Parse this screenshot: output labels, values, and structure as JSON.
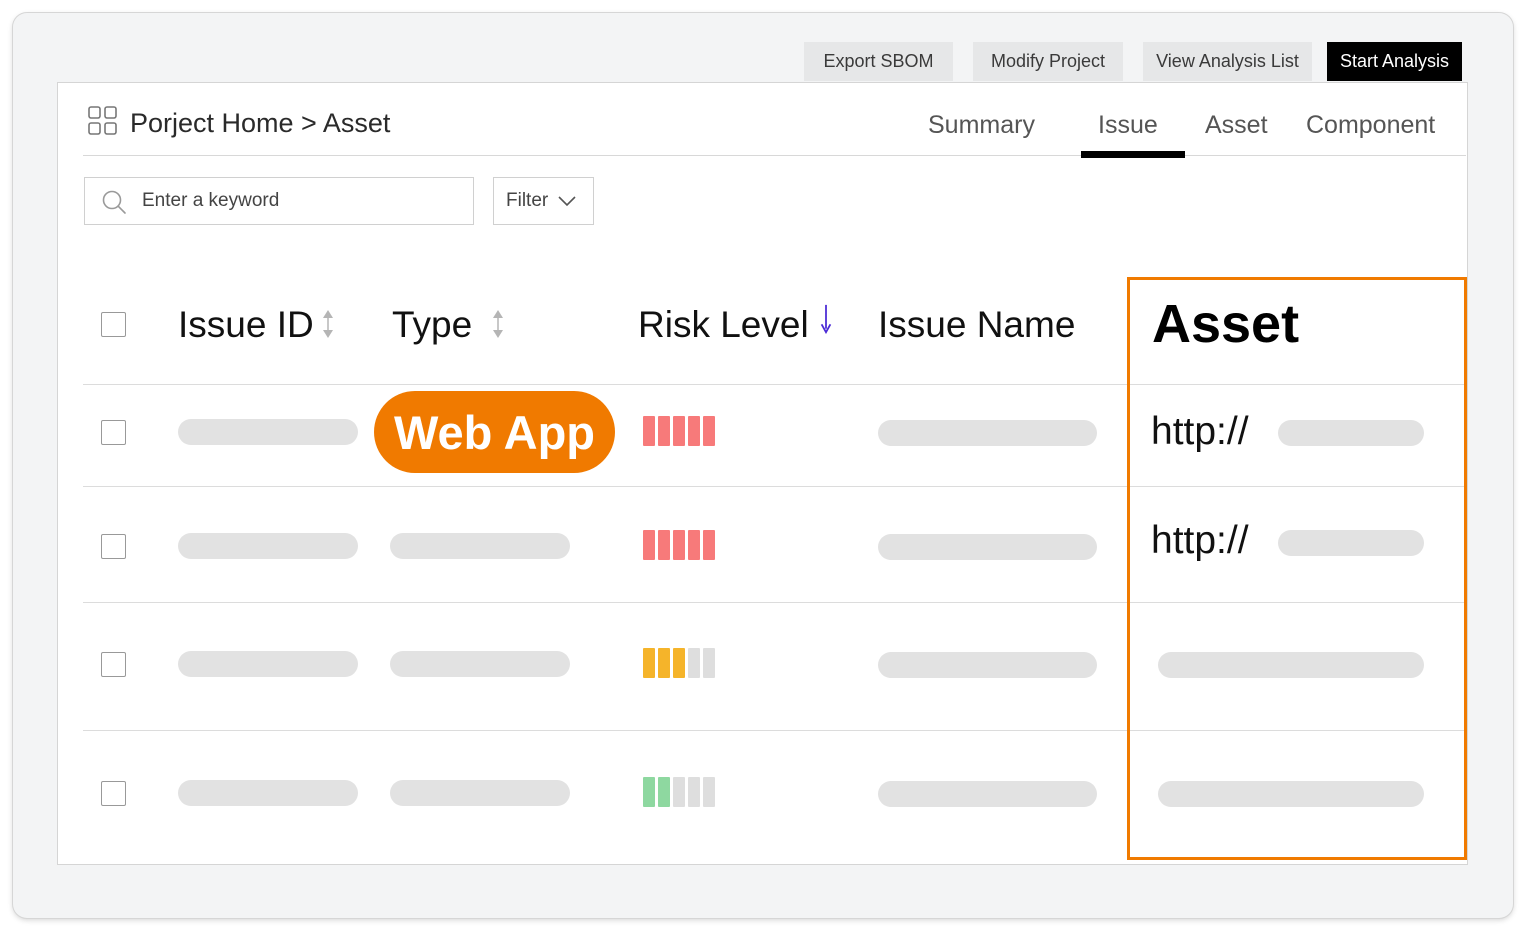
{
  "toolbar": {
    "export_sbom": "Export SBOM",
    "modify_project": "Modify Project",
    "view_analysis_list": "View Analysis List",
    "start_analysis": "Start Analysis"
  },
  "breadcrumb": {
    "text": "Porject Home > Asset",
    "icon": "grid-icon"
  },
  "tabs": [
    {
      "label": "Summary",
      "active": false
    },
    {
      "label": "Issue",
      "active": true
    },
    {
      "label": "Asset",
      "active": false
    },
    {
      "label": "Component",
      "active": false
    }
  ],
  "search": {
    "placeholder": "Enter a keyword",
    "icon": "search-icon"
  },
  "filter": {
    "label": "Filter",
    "icon": "chevron-down-icon"
  },
  "table": {
    "columns": [
      {
        "label": "Issue ID",
        "sort": "both"
      },
      {
        "label": "Type",
        "sort": "both"
      },
      {
        "label": "Risk Level",
        "sort": "desc"
      },
      {
        "label": "Issue Name",
        "sort": "none"
      },
      {
        "label": "Asset",
        "sort": "none",
        "highlighted": true
      }
    ],
    "rows": [
      {
        "type_badge": "Web App",
        "risk": {
          "filled": 5,
          "total": 5,
          "color": "#f77a7a"
        },
        "asset_prefix": "http://"
      },
      {
        "type_badge": "",
        "risk": {
          "filled": 5,
          "total": 5,
          "color": "#f77a7a"
        },
        "asset_prefix": "http://"
      },
      {
        "type_badge": "",
        "risk": {
          "filled": 3,
          "total": 5,
          "color": "#f5b42a"
        },
        "asset_prefix": ""
      },
      {
        "type_badge": "",
        "risk": {
          "filled": 2,
          "total": 5,
          "color": "#8ed8a0"
        },
        "asset_prefix": ""
      }
    ]
  },
  "colors": {
    "accent": "#f07a00",
    "primary_button": "#000000",
    "sort_desc_arrow": "#4b2bd6",
    "placeholder_pill": "#e2e2e2",
    "empty_bar": "#dedede"
  }
}
